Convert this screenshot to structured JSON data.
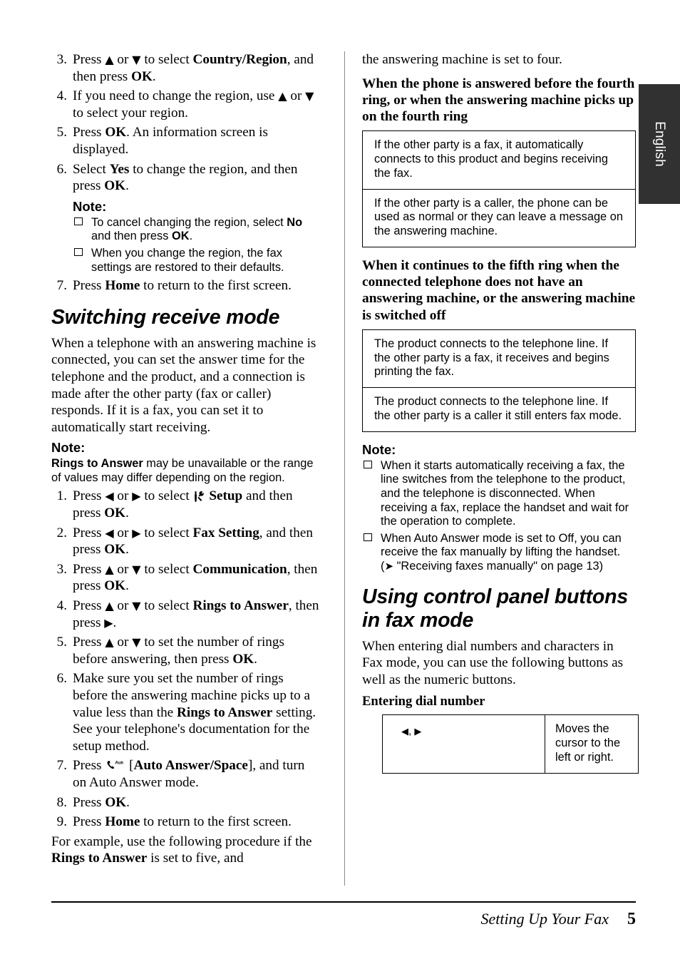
{
  "page": {
    "language_tab": "English",
    "footer_title": "Setting Up Your Fax",
    "footer_page_number": "5",
    "accent_tab_color": "#313131"
  },
  "left_column": {
    "steps_region": [
      {
        "num": "3.",
        "text_html": "Press <span class=\"arrow\">&#9650;</span> or <span class=\"arrow\">&#9660;</span> to select <b>Country/Region</b>, and then press <b>OK</b>."
      },
      {
        "num": "4.",
        "text_html": "If you need to change the region, use <span class=\"arrow\">&#9650;</span> or <span class=\"arrow\">&#9660;</span> to select your region."
      },
      {
        "num": "5.",
        "text_html": "Press <b>OK</b>. An information screen is displayed."
      },
      {
        "num": "6.",
        "text_html": "Select <b>Yes</b> to change the region, and then press <b>OK</b>."
      }
    ],
    "note1": {
      "heading": "Note:",
      "items_html": [
        "To cancel changing the region, select <span class=\"bs\">No</span> and then press <span class=\"bs\">OK</span>.",
        "When you change the region, the fax settings are restored to their defaults."
      ]
    },
    "step7_html": "Press <b>Home</b> to return to the first screen.",
    "step7_num": "7.",
    "section_heading": "Switching receive mode",
    "intro_paragraph": "When a telephone with an answering machine is connected, you can set the answer time for the telephone and the product, and a connection is made after the other party (fax or caller) responds. If it is a fax, you can set it to automatically start receiving.",
    "note2": {
      "heading": "Note:",
      "body_html": "<span class=\"bs\">Rings to Answer</span> may be unavailable or the range of values may differ depending on the region."
    },
    "steps_main": [
      {
        "num": "1.",
        "text_html": "Press <span class=\"arrow\">&#9664;</span> or <span class=\"arrow\">&#9654;</span> to select <span class=\"icon-setup\" data-icon=\"setup-tools-icon\"></span> <b>Setup</b> and then press <b>OK</b>."
      },
      {
        "num": "2.",
        "text_html": "Press <span class=\"arrow\">&#9664;</span> or <span class=\"arrow\">&#9654;</span> to select <b>Fax Setting</b>, and then press <b>OK</b>."
      },
      {
        "num": "3.",
        "text_html": "Press <span class=\"arrow\">&#9650;</span> or <span class=\"arrow\">&#9660;</span> to select <b>Communication</b>, then press <b>OK</b>."
      },
      {
        "num": "4.",
        "text_html": "Press <span class=\"arrow\">&#9650;</span> or <span class=\"arrow\">&#9660;</span> to select <b>Rings to Answer</b>, then press <span class=\"arrow\">&#9654;</span>."
      },
      {
        "num": "5.",
        "text_html": "Press <span class=\"arrow\">&#9650;</span> or <span class=\"arrow\">&#9660;</span> to set the number of rings before answering, then press <b>OK</b>."
      },
      {
        "num": "6.",
        "text_html": "Make sure you set the number of rings before the answering machine picks up to a value less than the <b>Rings to Answer</b> setting.<br>See your telephone's documentation for the setup method."
      },
      {
        "num": "7.",
        "text_html": "Press <span class=\"icon-phone\" data-icon=\"phone-auto-answer-icon\"></span> [<b>Auto Answer/Space</b>], and turn on Auto Answer mode."
      },
      {
        "num": "8.",
        "text_html": "Press <b>OK</b>."
      },
      {
        "num": "9.",
        "text_html": "Press <b>Home</b> to return to the first screen."
      }
    ],
    "closing_paragraph_html": "For example, use the following procedure if the <b>Rings to Answer</b> is set to five, and"
  },
  "right_column": {
    "continued_paragraph": "the answering machine is set to four.",
    "heading_1": "When the phone is answered before the fourth ring, or when the answering machine picks up on the fourth ring",
    "table_1": [
      "If the other party is a fax, it automatically connects to this product and begins receiving the fax.",
      "If the other party is a caller, the phone can be used as normal or they can leave a message on the answering machine."
    ],
    "heading_2": "When it continues to the fifth ring when the connected telephone does not have an answering machine, or the answering machine is switched off",
    "table_2": [
      "The product connects to the telephone line. If the other party is a fax, it receives and begins printing the fax.",
      "The product connects to the telephone line. If the other party is a caller it still enters fax mode."
    ],
    "note": {
      "heading": "Note:",
      "items_html": [
        "When it starts automatically receiving a fax, the line switches from the telephone to the product, and the telephone is disconnected. When receiving a fax, replace the handset and wait for the operation to complete.",
        "When Auto Answer mode is set to Off, you can receive the fax manually by lifting the handset. (<span class=\"rarrow\">&#10148;</span> \"Receiving faxes manually\" on page 13)"
      ]
    },
    "section_heading": "Using control panel buttons in fax mode",
    "intro_paragraph": "When entering dial numbers and characters in Fax mode, you can use the following buttons as well as the numeric buttons.",
    "sub_heading": "Entering dial number",
    "key_table": [
      {
        "key_html": "<span class=\"arrow-sm\">&#9664;</span>, <span class=\"arrow-sm\">&#9654;</span>",
        "description": "Moves the cursor to the left or right."
      }
    ]
  }
}
